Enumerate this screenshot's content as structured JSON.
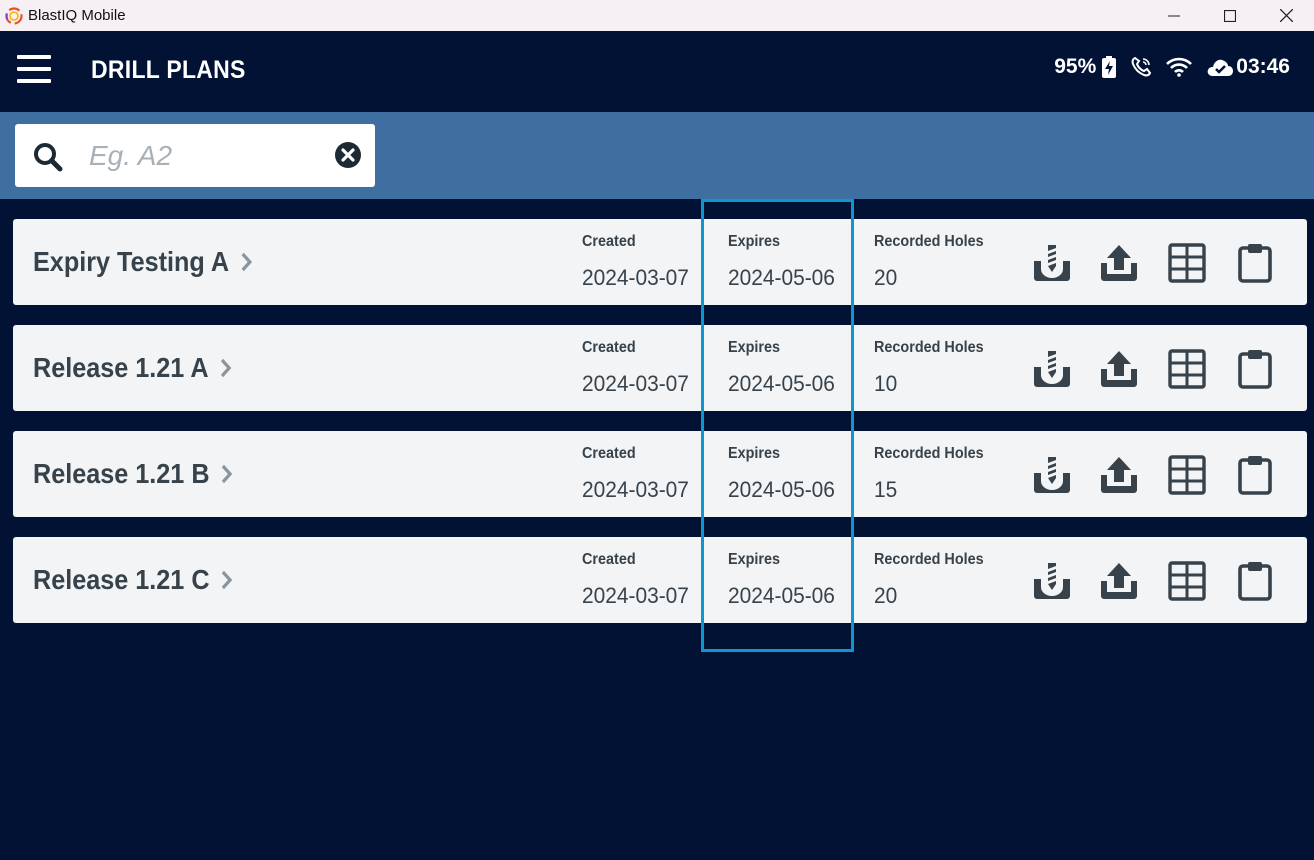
{
  "window": {
    "title": "BlastIQ Mobile"
  },
  "header": {
    "title": "DRILL PLANS",
    "battery": "95%",
    "clock": "03:46"
  },
  "search": {
    "placeholder": "Eg. A2",
    "value": ""
  },
  "columns": {
    "created": "Created",
    "expires": "Expires",
    "holes": "Recorded Holes"
  },
  "plans": [
    {
      "name": "Expiry Testing A",
      "created": "2024-03-07",
      "expires": "2024-05-06",
      "holes": "20"
    },
    {
      "name": "Release 1.21 A",
      "created": "2024-03-07",
      "expires": "2024-05-06",
      "holes": "10"
    },
    {
      "name": "Release 1.21 B",
      "created": "2024-03-07",
      "expires": "2024-05-06",
      "holes": "15"
    },
    {
      "name": "Release 1.21 C",
      "created": "2024-03-07",
      "expires": "2024-05-06",
      "holes": "20"
    }
  ],
  "icons": {
    "menu": "hamburger-menu-icon",
    "battery": "battery-charging-icon",
    "phone": "phone-icon",
    "wifi": "wifi-icon",
    "cloud": "cloud-done-icon",
    "search": "search-icon",
    "clear": "clear-circle-icon",
    "row_actions": [
      "drill-icon",
      "upload-icon",
      "grid-icon",
      "clipboard-icon"
    ]
  },
  "colors": {
    "app_background": "#021235",
    "search_band": "#3e6fa0",
    "card": "#f2f4f6",
    "text": "#37424a",
    "highlight": "#0e96d0"
  }
}
